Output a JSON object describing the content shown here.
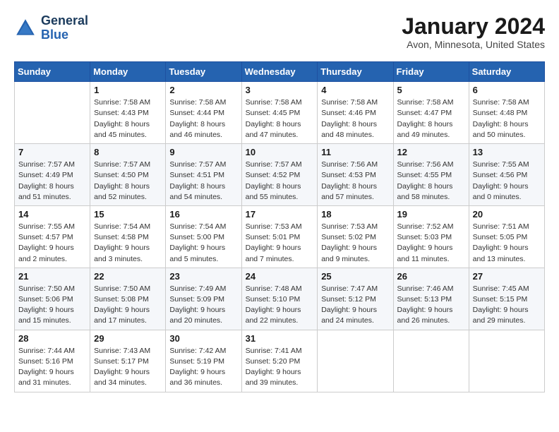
{
  "header": {
    "logo_line1": "General",
    "logo_line2": "Blue",
    "month_title": "January 2024",
    "location": "Avon, Minnesota, United States"
  },
  "weekdays": [
    "Sunday",
    "Monday",
    "Tuesday",
    "Wednesday",
    "Thursday",
    "Friday",
    "Saturday"
  ],
  "weeks": [
    [
      {
        "day": "",
        "info": ""
      },
      {
        "day": "1",
        "info": "Sunrise: 7:58 AM\nSunset: 4:43 PM\nDaylight: 8 hours\nand 45 minutes."
      },
      {
        "day": "2",
        "info": "Sunrise: 7:58 AM\nSunset: 4:44 PM\nDaylight: 8 hours\nand 46 minutes."
      },
      {
        "day": "3",
        "info": "Sunrise: 7:58 AM\nSunset: 4:45 PM\nDaylight: 8 hours\nand 47 minutes."
      },
      {
        "day": "4",
        "info": "Sunrise: 7:58 AM\nSunset: 4:46 PM\nDaylight: 8 hours\nand 48 minutes."
      },
      {
        "day": "5",
        "info": "Sunrise: 7:58 AM\nSunset: 4:47 PM\nDaylight: 8 hours\nand 49 minutes."
      },
      {
        "day": "6",
        "info": "Sunrise: 7:58 AM\nSunset: 4:48 PM\nDaylight: 8 hours\nand 50 minutes."
      }
    ],
    [
      {
        "day": "7",
        "info": "Sunrise: 7:57 AM\nSunset: 4:49 PM\nDaylight: 8 hours\nand 51 minutes."
      },
      {
        "day": "8",
        "info": "Sunrise: 7:57 AM\nSunset: 4:50 PM\nDaylight: 8 hours\nand 52 minutes."
      },
      {
        "day": "9",
        "info": "Sunrise: 7:57 AM\nSunset: 4:51 PM\nDaylight: 8 hours\nand 54 minutes."
      },
      {
        "day": "10",
        "info": "Sunrise: 7:57 AM\nSunset: 4:52 PM\nDaylight: 8 hours\nand 55 minutes."
      },
      {
        "day": "11",
        "info": "Sunrise: 7:56 AM\nSunset: 4:53 PM\nDaylight: 8 hours\nand 57 minutes."
      },
      {
        "day": "12",
        "info": "Sunrise: 7:56 AM\nSunset: 4:55 PM\nDaylight: 8 hours\nand 58 minutes."
      },
      {
        "day": "13",
        "info": "Sunrise: 7:55 AM\nSunset: 4:56 PM\nDaylight: 9 hours\nand 0 minutes."
      }
    ],
    [
      {
        "day": "14",
        "info": "Sunrise: 7:55 AM\nSunset: 4:57 PM\nDaylight: 9 hours\nand 2 minutes."
      },
      {
        "day": "15",
        "info": "Sunrise: 7:54 AM\nSunset: 4:58 PM\nDaylight: 9 hours\nand 3 minutes."
      },
      {
        "day": "16",
        "info": "Sunrise: 7:54 AM\nSunset: 5:00 PM\nDaylight: 9 hours\nand 5 minutes."
      },
      {
        "day": "17",
        "info": "Sunrise: 7:53 AM\nSunset: 5:01 PM\nDaylight: 9 hours\nand 7 minutes."
      },
      {
        "day": "18",
        "info": "Sunrise: 7:53 AM\nSunset: 5:02 PM\nDaylight: 9 hours\nand 9 minutes."
      },
      {
        "day": "19",
        "info": "Sunrise: 7:52 AM\nSunset: 5:03 PM\nDaylight: 9 hours\nand 11 minutes."
      },
      {
        "day": "20",
        "info": "Sunrise: 7:51 AM\nSunset: 5:05 PM\nDaylight: 9 hours\nand 13 minutes."
      }
    ],
    [
      {
        "day": "21",
        "info": "Sunrise: 7:50 AM\nSunset: 5:06 PM\nDaylight: 9 hours\nand 15 minutes."
      },
      {
        "day": "22",
        "info": "Sunrise: 7:50 AM\nSunset: 5:08 PM\nDaylight: 9 hours\nand 17 minutes."
      },
      {
        "day": "23",
        "info": "Sunrise: 7:49 AM\nSunset: 5:09 PM\nDaylight: 9 hours\nand 20 minutes."
      },
      {
        "day": "24",
        "info": "Sunrise: 7:48 AM\nSunset: 5:10 PM\nDaylight: 9 hours\nand 22 minutes."
      },
      {
        "day": "25",
        "info": "Sunrise: 7:47 AM\nSunset: 5:12 PM\nDaylight: 9 hours\nand 24 minutes."
      },
      {
        "day": "26",
        "info": "Sunrise: 7:46 AM\nSunset: 5:13 PM\nDaylight: 9 hours\nand 26 minutes."
      },
      {
        "day": "27",
        "info": "Sunrise: 7:45 AM\nSunset: 5:15 PM\nDaylight: 9 hours\nand 29 minutes."
      }
    ],
    [
      {
        "day": "28",
        "info": "Sunrise: 7:44 AM\nSunset: 5:16 PM\nDaylight: 9 hours\nand 31 minutes."
      },
      {
        "day": "29",
        "info": "Sunrise: 7:43 AM\nSunset: 5:17 PM\nDaylight: 9 hours\nand 34 minutes."
      },
      {
        "day": "30",
        "info": "Sunrise: 7:42 AM\nSunset: 5:19 PM\nDaylight: 9 hours\nand 36 minutes."
      },
      {
        "day": "31",
        "info": "Sunrise: 7:41 AM\nSunset: 5:20 PM\nDaylight: 9 hours\nand 39 minutes."
      },
      {
        "day": "",
        "info": ""
      },
      {
        "day": "",
        "info": ""
      },
      {
        "day": "",
        "info": ""
      }
    ]
  ]
}
